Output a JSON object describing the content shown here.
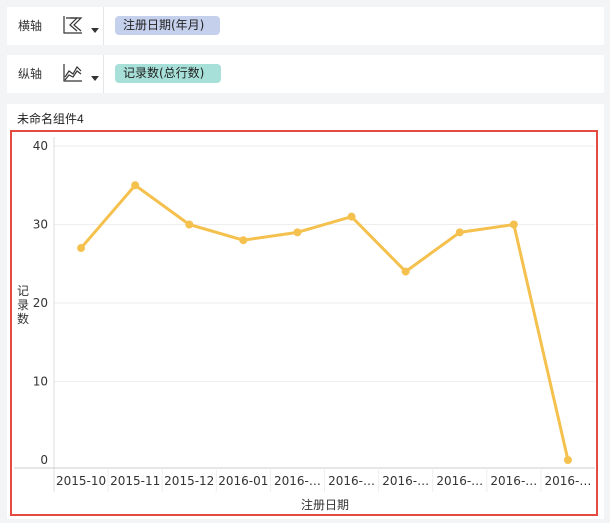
{
  "fields": {
    "x_axis": {
      "label": "横轴",
      "pill": "注册日期(年月)",
      "chart_type_icon": "axis-chart-icon"
    },
    "y_axis": {
      "label": "纵轴",
      "pill": "记录数(总行数)",
      "chart_type_icon": "line-chart-icon"
    }
  },
  "widget": {
    "title": "未命名组件4"
  },
  "colors": {
    "line": "#f5c14e",
    "frame": "#e34b40",
    "pill_x": "#c5d0ec",
    "pill_y": "#a6e0d8"
  },
  "chart_data": {
    "type": "line",
    "categories": [
      "2015-10",
      "2015-11",
      "2015-12",
      "2016-01",
      "2016-…",
      "2016-…",
      "2016-…",
      "2016-…",
      "2016-…",
      "2016-…"
    ],
    "values": [
      27,
      35,
      30,
      28,
      29,
      31,
      24,
      29,
      30,
      0
    ],
    "xlabel": "注册日期",
    "ylabel": "记录数",
    "ylim": [
      0,
      40
    ],
    "yticks": [
      0,
      10,
      20,
      30,
      40
    ],
    "grid": true,
    "legend": "none"
  }
}
